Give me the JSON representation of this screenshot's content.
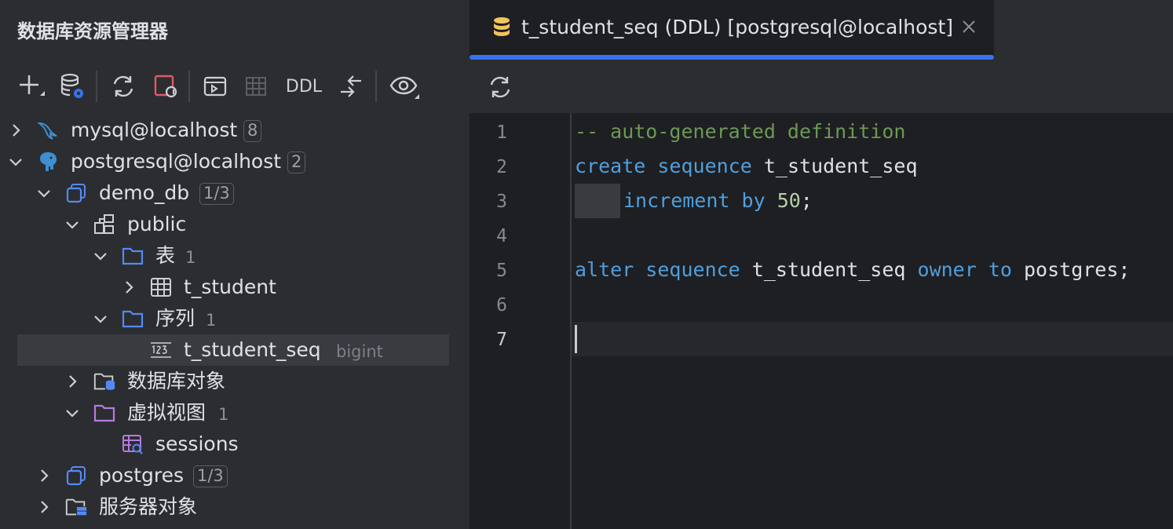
{
  "explorer": {
    "title": "数据库资源管理器",
    "toolbar": {
      "ddl_label": "DDL"
    },
    "tree": [
      {
        "label": "mysql@localhost",
        "badge": "8"
      },
      {
        "label": "postgresql@localhost",
        "badge": "2"
      },
      {
        "label": "demo_db",
        "badge": "1/3"
      },
      {
        "label": "public"
      },
      {
        "label": "表",
        "count": "1"
      },
      {
        "label": "t_student"
      },
      {
        "label": "序列",
        "count": "1"
      },
      {
        "label": "t_student_seq",
        "hint": "bigint"
      },
      {
        "label": "数据库对象"
      },
      {
        "label": "虚拟视图",
        "count": "1"
      },
      {
        "label": "sessions"
      },
      {
        "label": "postgres",
        "badge": "1/3"
      },
      {
        "label": "服务器对象"
      }
    ]
  },
  "editor": {
    "tab_title": "t_student_seq (DDL) [postgresql@localhost]",
    "line_numbers": [
      "1",
      "2",
      "3",
      "4",
      "5",
      "6",
      "7"
    ],
    "code": {
      "l1_comment": "-- auto-generated definition",
      "l2_kw": "create sequence",
      "l2_id": "t_student_seq",
      "l3_kw": "increment by",
      "l3_num": "50",
      "l3_end": ";",
      "l5_kw1": "alter sequence",
      "l5_id": "t_student_seq",
      "l5_kw2": "owner to",
      "l5_id2": "postgres",
      "l5_end": ";"
    }
  },
  "colors": {
    "accent": "#3574f0",
    "keyword": "#4f9fde",
    "comment": "#6a9955",
    "number": "#b5cea8",
    "folder_blue": "#548af7",
    "folder_purple": "#b47be0",
    "tab_icon": "#f2c55c"
  },
  "icons": {
    "toolbar": [
      "plus-icon",
      "datasource-settings-icon",
      "refresh-icon",
      "disconnect-icon",
      "console-icon",
      "table-icon",
      "ddl-text",
      "jump-icon",
      "eye-icon"
    ],
    "tree": [
      "mysql-dolphin-icon",
      "postgresql-elephant-icon",
      "database-icon",
      "schema-icon",
      "folder-icon",
      "table-icon",
      "sequence-123-icon",
      "database-objects-folder-icon",
      "virtual-views-folder-icon",
      "virtual-view-icon",
      "server-objects-folder-icon"
    ]
  }
}
